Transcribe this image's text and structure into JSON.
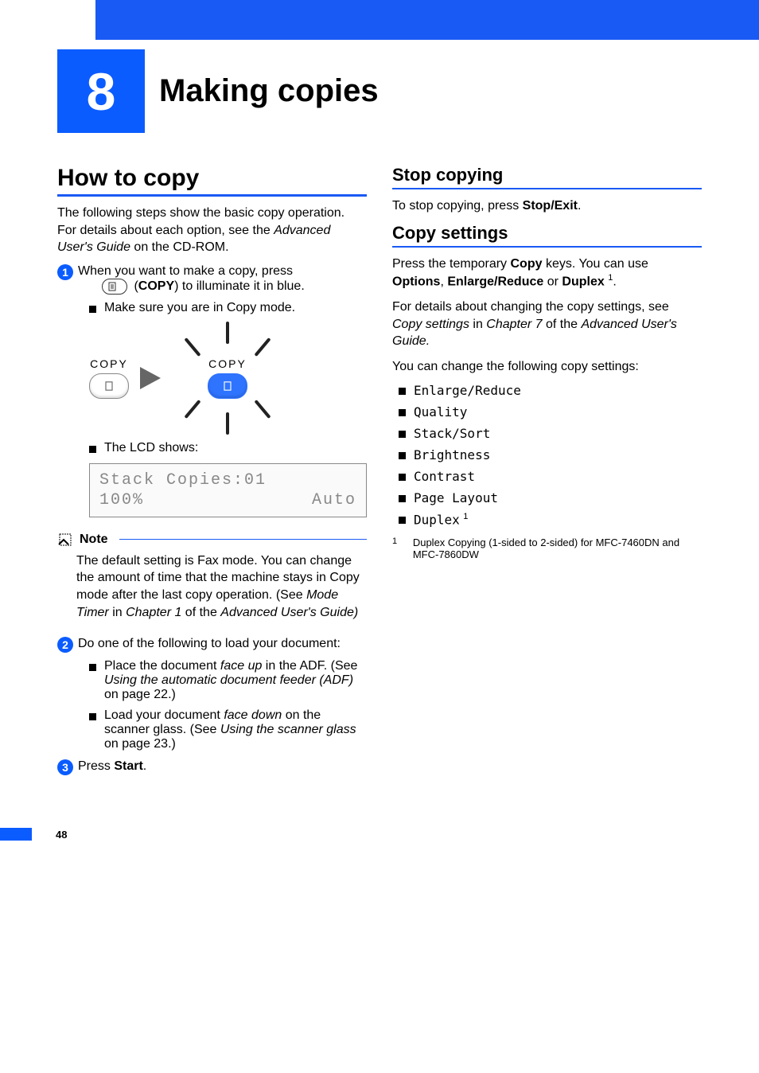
{
  "chapter": {
    "number": "8",
    "title": "Making copies"
  },
  "left": {
    "h2": "How to copy",
    "intro_a": "The following steps show the basic copy operation. For details about each option, see the ",
    "intro_b": "Advanced User's Guide",
    "intro_c": " on the CD-ROM.",
    "step1_a": "When you want to make a copy, press ",
    "step1_copy": "COPY",
    "step1_b": ") to illuminate it in blue.",
    "step1_bullet": "Make sure you are in Copy mode.",
    "diagram_label": "COPY",
    "lcd_intro": "The LCD shows:",
    "lcd_l1": "Stack   Copies:01",
    "lcd_l2a": "100%",
    "lcd_l2b": "Auto",
    "note_label": "Note",
    "note_a": "The default setting is Fax mode. You can change the amount of time that the machine stays in Copy mode after the last copy operation. (See ",
    "note_b": "Mode Timer",
    "note_c": " in ",
    "note_d": "Chapter 1",
    "note_e": " of the ",
    "note_f": "Advanced User's Guide)",
    "step2": "Do one of the following to load your document:",
    "s2b1_a": "Place the document ",
    "s2b1_b": "face up",
    "s2b1_c": " in the ADF. (See ",
    "s2b1_d": "Using the automatic document feeder (ADF)",
    "s2b1_e": " on page 22.)",
    "s2b2_a": "Load your document ",
    "s2b2_b": "face down",
    "s2b2_c": " on the scanner glass. (See ",
    "s2b2_d": "Using the scanner glass",
    "s2b2_e": " on page 23.)",
    "step3_a": "Press ",
    "step3_b": "Start",
    "step3_c": "."
  },
  "right": {
    "h3a": "Stop copying",
    "stop_a": "To stop copying, press ",
    "stop_b": "Stop/Exit",
    "stop_c": ".",
    "h3b": "Copy settings",
    "cs1_a": "Press the temporary ",
    "cs1_b": "Copy",
    "cs1_c": " keys. You can use ",
    "cs1_d": "Options",
    "cs1_e": ", ",
    "cs1_f": "Enlarge/Reduce",
    "cs1_g": " or ",
    "cs1_h": "Duplex",
    "cs1_i": ".",
    "cs2_a": "For details about changing the copy settings, see ",
    "cs2_b": "Copy settings",
    "cs2_c": " in ",
    "cs2_d": "Chapter 7",
    "cs2_e": " of the ",
    "cs2_f": "Advanced User's Guide.",
    "cs3": "You can change the following copy settings:",
    "items": {
      "i0": "Enlarge/Reduce",
      "i1": "Quality",
      "i2": "Stack/Sort",
      "i3": "Brightness",
      "i4": "Contrast",
      "i5": "Page Layout",
      "i6": "Duplex"
    },
    "fn_mark": "1",
    "fn_text": "Duplex Copying (1-sided to 2-sided) for MFC-7460DN and MFC-7860DW"
  },
  "page_number": "48"
}
